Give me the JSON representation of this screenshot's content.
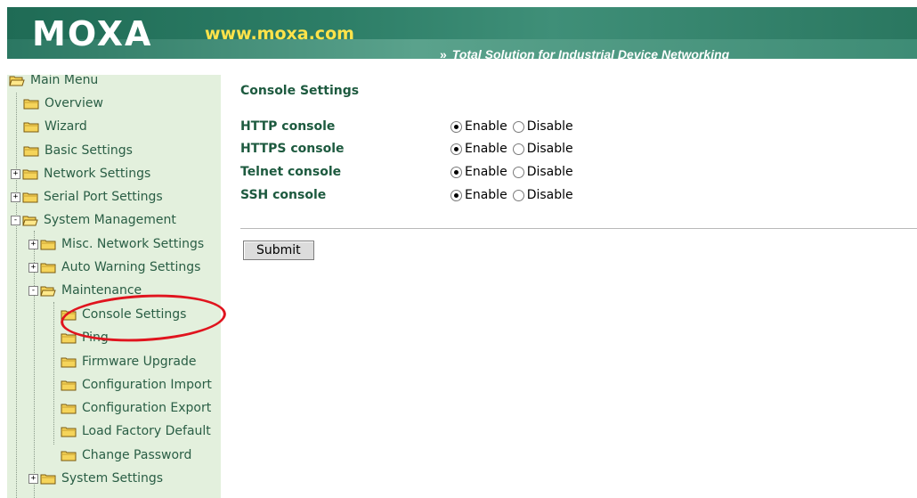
{
  "header": {
    "logo": "MOXA",
    "site": "www.moxa.com",
    "tagline": "Total Solution for Industrial Device Networking",
    "tagline_prefix": "»"
  },
  "sidebar": {
    "items": [
      {
        "label": "Main Menu",
        "icon": "open-folder-icon",
        "expander": ""
      },
      {
        "label": "Overview",
        "icon": "folder-icon",
        "expander": ""
      },
      {
        "label": "Wizard",
        "icon": "folder-icon",
        "expander": ""
      },
      {
        "label": "Basic Settings",
        "icon": "folder-icon",
        "expander": ""
      },
      {
        "label": "Network Settings",
        "icon": "folder-icon",
        "expander": "+"
      },
      {
        "label": "Serial Port Settings",
        "icon": "folder-icon",
        "expander": "+"
      },
      {
        "label": "System Management",
        "icon": "open-folder-icon",
        "expander": "-"
      },
      {
        "label": "Misc. Network Settings",
        "icon": "folder-icon",
        "expander": "+"
      },
      {
        "label": "Auto Warning Settings",
        "icon": "folder-icon",
        "expander": "+"
      },
      {
        "label": "Maintenance",
        "icon": "open-folder-icon",
        "expander": "-"
      },
      {
        "label": "Console Settings",
        "icon": "folder-icon",
        "expander": ""
      },
      {
        "label": "Ping",
        "icon": "folder-icon",
        "expander": ""
      },
      {
        "label": "Firmware Upgrade",
        "icon": "folder-icon",
        "expander": ""
      },
      {
        "label": "Configuration Import",
        "icon": "folder-icon",
        "expander": ""
      },
      {
        "label": "Configuration Export",
        "icon": "folder-icon",
        "expander": ""
      },
      {
        "label": "Load Factory Default",
        "icon": "folder-icon",
        "expander": ""
      },
      {
        "label": "Change Password",
        "icon": "folder-icon",
        "expander": ""
      },
      {
        "label": "System Settings",
        "icon": "folder-icon",
        "expander": "+"
      }
    ]
  },
  "main": {
    "title": "Console Settings",
    "rows": [
      {
        "label": "HTTP console",
        "enable": "Enable",
        "disable": "Disable",
        "selected": "enable"
      },
      {
        "label": "HTTPS console",
        "enable": "Enable",
        "disable": "Disable",
        "selected": "enable"
      },
      {
        "label": "Telnet console",
        "enable": "Enable",
        "disable": "Disable",
        "selected": "enable"
      },
      {
        "label": "SSH console",
        "enable": "Enable",
        "disable": "Disable",
        "selected": "enable"
      }
    ],
    "submit_label": "Submit"
  },
  "colors": {
    "header_green": "#29745f",
    "sidebar_bg": "#e3f0dd",
    "label_green": "#1d5a3f",
    "site_yellow": "#ffe34a",
    "highlight_red": "#e0141e"
  }
}
